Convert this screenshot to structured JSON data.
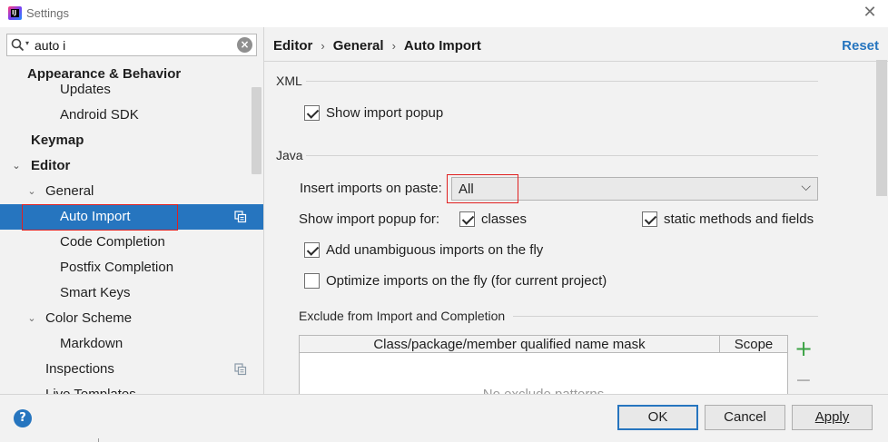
{
  "window": {
    "title": "Settings",
    "app_icon": "intellij-icon",
    "close_icon": "close-icon"
  },
  "search": {
    "value": "auto i",
    "icon": "search-icon",
    "clear_icon": "clear-icon"
  },
  "sidebar": {
    "items": [
      {
        "label": "Appearance & Behavior",
        "bold": true
      },
      {
        "label": "Updates"
      },
      {
        "label": "Android SDK"
      },
      {
        "label": "Keymap",
        "bold": true
      },
      {
        "label": "Editor",
        "bold": true,
        "expanded": true
      },
      {
        "label": "General",
        "expanded": true
      },
      {
        "label": "Auto Import",
        "selected": true
      },
      {
        "label": "Code Completion"
      },
      {
        "label": "Postfix Completion"
      },
      {
        "label": "Smart Keys"
      },
      {
        "label": "Color Scheme",
        "expanded": true
      },
      {
        "label": "Markdown"
      },
      {
        "label": "Inspections"
      },
      {
        "label": "Live Templates"
      }
    ],
    "arrow_expanded": "⌄",
    "copy_icon": "copy-project-icon"
  },
  "breadcrumb": {
    "parts": [
      "Editor",
      "General",
      "Auto Import"
    ],
    "separator": "›"
  },
  "reset_label": "Reset",
  "xml_section": {
    "title": "XML",
    "show_import_popup": {
      "label": "Show import popup",
      "checked": true
    }
  },
  "java_section": {
    "title": "Java",
    "insert_imports_label": "Insert imports on paste:",
    "insert_imports_value": "All",
    "show_popup_for_label": "Show import popup for:",
    "classes": {
      "label": "classes",
      "checked": true
    },
    "static_methods": {
      "label": "static methods and fields",
      "checked": true
    },
    "add_unambiguous": {
      "label": "Add unambiguous imports on the fly",
      "checked": true
    },
    "optimize_imports": {
      "label": "Optimize imports on the fly (for current project)",
      "checked": false
    }
  },
  "exclude_section": {
    "title": "Exclude from Import and Completion",
    "columns": [
      "Class/package/member qualified name mask",
      "Scope"
    ],
    "empty_text": "No exclude patterns",
    "add_icon": "add-icon",
    "remove_icon": "remove-icon"
  },
  "footer": {
    "help_icon": "help-icon",
    "ok_label": "OK",
    "cancel_label": "Cancel",
    "apply_label": "Apply"
  }
}
